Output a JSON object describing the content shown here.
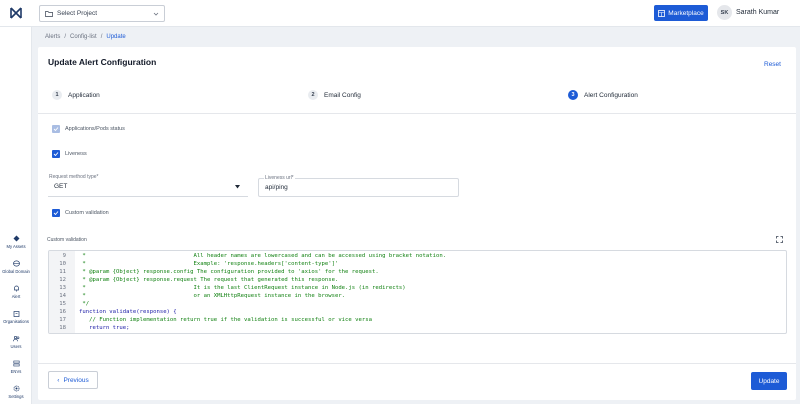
{
  "header": {
    "project_select": "Select Project",
    "marketplace": "Marketplace",
    "user_initials": "SK",
    "user_name": "Sarath Kumar"
  },
  "sidebar": {
    "items": [
      {
        "label": "My Assets",
        "icon": "assets-icon"
      },
      {
        "label": "Global Domain",
        "icon": "globe-icon"
      },
      {
        "label": "Alert",
        "icon": "bell-icon"
      },
      {
        "label": "Organisations",
        "icon": "building-icon"
      },
      {
        "label": "Users",
        "icon": "users-icon"
      },
      {
        "label": "ENVs",
        "icon": "env-icon"
      },
      {
        "label": "Settings",
        "icon": "gear-icon"
      }
    ]
  },
  "breadcrumb": [
    "Alerts",
    "Config-list",
    "Update"
  ],
  "page": {
    "title": "Update Alert Configuration",
    "reset": "Reset"
  },
  "steps": [
    {
      "num": "1",
      "label": "Application",
      "active": false
    },
    {
      "num": "2",
      "label": "Email Config",
      "active": false
    },
    {
      "num": "3",
      "label": "Alert Configuration",
      "active": true
    }
  ],
  "form": {
    "apps_status": "Applications/Pods status",
    "liveness": "Liveness",
    "request_method_label": "Request method type*",
    "request_method_value": "GET",
    "liveness_url_label": "Liveness url*",
    "liveness_url_value": "api/ping",
    "custom_validation_check": "Custom validation",
    "custom_validation_label": "Custom validation"
  },
  "code_lines": [
    {
      "ln": "9",
      "text": " *                                All header names are lowercased and can be accessed using bracket notation."
    },
    {
      "ln": "10",
      "text": " *                                Example: 'response.headers['content-type']'"
    },
    {
      "ln": "11",
      "text": " * @param {Object} response.config The configuration provided to 'axios' for the request."
    },
    {
      "ln": "12",
      "text": " * @param {Object} response.request The request that generated this response."
    },
    {
      "ln": "13",
      "text": " *                                It is the last ClientRequest instance in Node.js (in redirects)"
    },
    {
      "ln": "14",
      "text": " *                                or an XMLHttpRequest instance in the browser."
    },
    {
      "ln": "15",
      "text": " */"
    },
    {
      "ln": "16",
      "text": "function validate(response) {"
    },
    {
      "ln": "17",
      "text": "   // Function implementation return true if the validation is successful or vice versa"
    },
    {
      "ln": "18",
      "text": "   return true;"
    },
    {
      "ln": "19",
      "text": "}"
    }
  ],
  "footer": {
    "previous": "Previous",
    "update": "Update"
  },
  "colors": {
    "accent": "#1d5bd6",
    "background": "#eef1f5"
  }
}
